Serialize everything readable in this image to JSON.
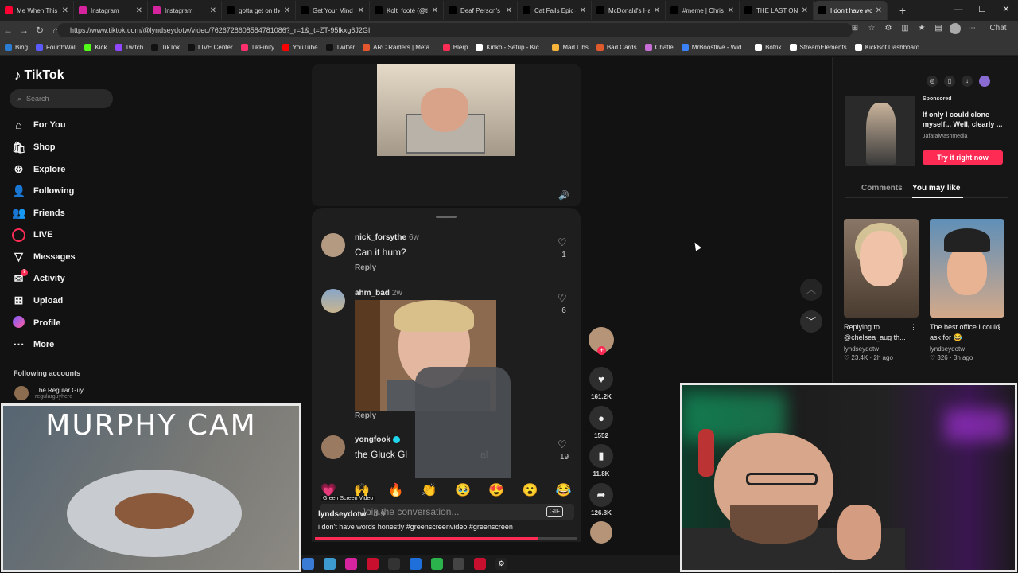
{
  "browser": {
    "tabs": [
      {
        "title": "Me When This Sc",
        "color": "#ff0033"
      },
      {
        "title": "Instagram",
        "color": "#d6249f"
      },
      {
        "title": "Instagram",
        "color": "#d6249f"
      },
      {
        "title": "gotta get on the",
        "color": "#000000"
      },
      {
        "title": "Get Your Mind R",
        "color": "#000000"
      },
      {
        "title": "Kolt_footé (@the",
        "color": "#000000"
      },
      {
        "title": "Deaf Person's M",
        "color": "#000000"
      },
      {
        "title": "Cat Fails Epic Jun",
        "color": "#000000"
      },
      {
        "title": "McDonald's Hap",
        "color": "#000000"
      },
      {
        "title": "#meme | Chris Fa",
        "color": "#000000"
      },
      {
        "title": "THE LAST ONE 😭",
        "color": "#000000"
      },
      {
        "title": "I don't have wor",
        "color": "#000000",
        "active": true
      }
    ],
    "url": "https://www.tiktok.com/@lyndseydotw/video/7626728608584781086?_r=1&_t=ZT-95lkxg6J2GIl",
    "chat_label": "Chat",
    "bookmarks": [
      {
        "label": "Bing",
        "color": "#2b7cd3"
      },
      {
        "label": "FourthWall",
        "color": "#5a5aff"
      },
      {
        "label": "Kick",
        "color": "#53fc18"
      },
      {
        "label": "Twitch",
        "color": "#9146ff"
      },
      {
        "label": "TikTok",
        "color": "#111111"
      },
      {
        "label": "LIVE Center",
        "color": "#111111"
      },
      {
        "label": "TikFinity",
        "color": "#ff2f6d"
      },
      {
        "label": "YouTube",
        "color": "#ff0000"
      },
      {
        "label": "Twitter",
        "color": "#111111"
      },
      {
        "label": "ARC Raiders | Meta...",
        "color": "#e4572e"
      },
      {
        "label": "Blerp",
        "color": "#ff2d55"
      },
      {
        "label": "Kinko - Setup - Kic...",
        "color": "#ffffff"
      },
      {
        "label": "Mad Libs",
        "color": "#f6b43b"
      },
      {
        "label": "Bad Cards",
        "color": "#e05a2b"
      },
      {
        "label": "Chatle",
        "color": "#c86dd7"
      },
      {
        "label": "MrBoostlive - Wid...",
        "color": "#3b82f6"
      },
      {
        "label": "Botrix",
        "color": "#ffffff"
      },
      {
        "label": "StreamElements",
        "color": "#ffffff"
      },
      {
        "label": "KickBot Dashboard",
        "color": "#ffffff"
      }
    ]
  },
  "tiktok": {
    "logo": "TikTok",
    "search_placeholder": "Search",
    "nav": [
      {
        "label": "For You",
        "icon": "home-icon"
      },
      {
        "label": "Shop",
        "icon": "shop-icon"
      },
      {
        "label": "Explore",
        "icon": "compass-icon"
      },
      {
        "label": "Following",
        "icon": "following-icon"
      },
      {
        "label": "Friends",
        "icon": "friends-icon"
      },
      {
        "label": "LIVE",
        "icon": "live-icon"
      },
      {
        "label": "Messages",
        "icon": "messages-icon"
      },
      {
        "label": "Activity",
        "icon": "activity-icon",
        "badge": "7"
      },
      {
        "label": "Upload",
        "icon": "upload-icon"
      },
      {
        "label": "Profile",
        "icon": "profile-icon"
      },
      {
        "label": "More",
        "icon": "more-icon"
      }
    ],
    "following_title": "Following accounts",
    "following": [
      {
        "name": "The Regular Guy",
        "handle": "regularguyhere"
      }
    ],
    "comments": [
      {
        "user": "nick_forsythe",
        "ago": "6w",
        "text": "Can it hum?",
        "likes": "1",
        "reply": "Reply"
      },
      {
        "user": "ahm_bad",
        "ago": "2w",
        "text": "",
        "likes": "6",
        "reply": "Reply"
      },
      {
        "user": "yongfook",
        "ago": "",
        "text": "the Gluck Gl",
        "text_end": "al",
        "likes": "19",
        "reply": "Reply"
      }
    ],
    "emojis": [
      "💗",
      "🙌",
      "🔥",
      "👏",
      "🥹",
      "😍",
      "😮",
      "😂"
    ],
    "comment_placeholder": "Join the conversation...",
    "gif_label": "GIF",
    "green_screen_tag": "Green Screen Video",
    "author": "lyndseydotw",
    "author_date": "4-9",
    "caption": "i don't have words honestly #greenscreenvideo #greenscreen",
    "progress": 0.85,
    "actions": {
      "likes": "161.2K",
      "comments": "1552",
      "saves": "11.8K",
      "shares": "126.8K"
    },
    "sponsored": {
      "label": "Sponsored",
      "text": "If only I could clone myself... Well, clearly ...",
      "handle": "Jafaralwashmedia",
      "cta": "Try it right now"
    },
    "right_tabs": [
      "Comments",
      "You may like"
    ],
    "suggested": [
      {
        "caption": "Replying to @chelsea_aug th...",
        "handle": "lyndseydotw",
        "likes": "23.4K",
        "ago": "2h ago"
      },
      {
        "caption": "The best office I could ask for 😂",
        "handle": "lyndseydotw",
        "likes": "326",
        "ago": "3h ago"
      }
    ]
  },
  "overlays": {
    "murphy_title": "MURPHY CAM"
  }
}
